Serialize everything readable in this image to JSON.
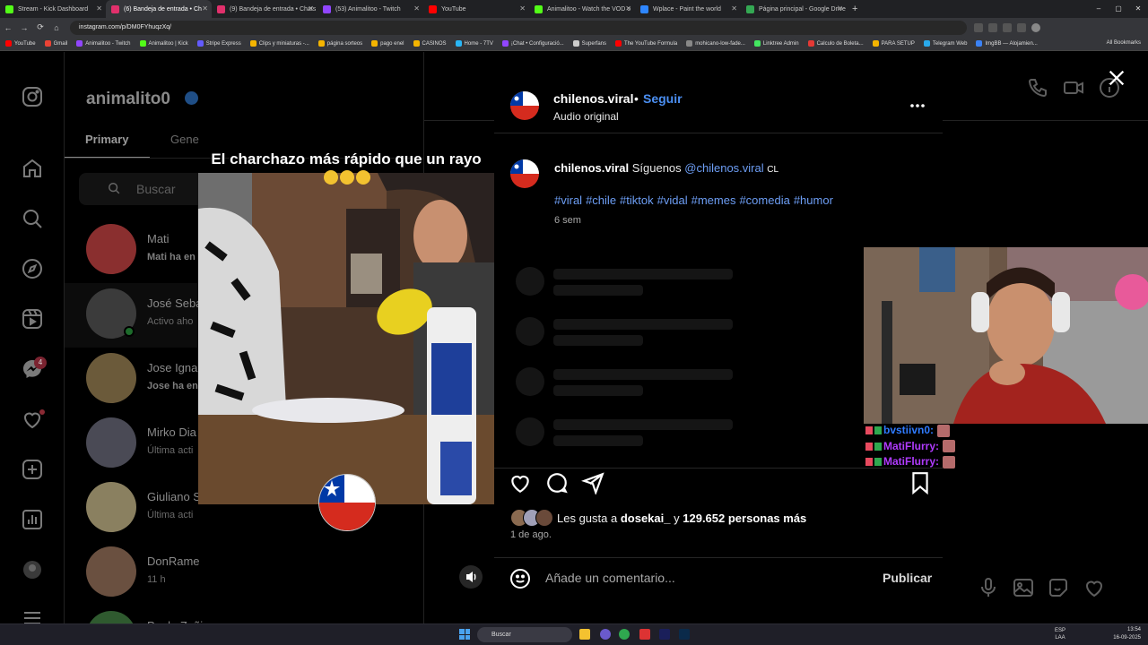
{
  "browser": {
    "tabs": [
      {
        "label": "Stream - Kick Dashboard",
        "color": "#53fc18",
        "active": false
      },
      {
        "label": "(6) Bandeja de entrada • Ch",
        "color": "#e1306c",
        "active": true
      },
      {
        "label": "(9) Bandeja de entrada • Chats",
        "color": "#e1306c",
        "active": false
      },
      {
        "label": "(53) Animalitoo - Twitch",
        "color": "#9146ff",
        "active": false
      },
      {
        "label": "YouTube",
        "color": "#ff0000",
        "active": false
      },
      {
        "label": "Animalitoo - Watch the VOD o",
        "color": "#53fc18",
        "active": false
      },
      {
        "label": "Wplace - Paint the world",
        "color": "#2e86ff",
        "active": false
      },
      {
        "label": "Página principal - Google Drive",
        "color": "#34a853",
        "active": false
      }
    ],
    "new_tab": "+",
    "url": "instagram.com/p/DM0FYhuqzXq/",
    "bookmarks": [
      {
        "label": "YouTube",
        "color": "#ff0000"
      },
      {
        "label": "Gmail",
        "color": "#ea4335"
      },
      {
        "label": "Animalitoo - Twitch",
        "color": "#9146ff"
      },
      {
        "label": "Animalitoo | Kick",
        "color": "#53fc18"
      },
      {
        "label": "Stripe Express",
        "color": "#635bff"
      },
      {
        "label": "Clips y miniaturas -...",
        "color": "#f4b400"
      },
      {
        "label": "página sorteos",
        "color": "#f4b400"
      },
      {
        "label": "pago enel",
        "color": "#f4b400"
      },
      {
        "label": "CASINOS",
        "color": "#f4b400"
      },
      {
        "label": "Home - 7TV",
        "color": "#29b6f6"
      },
      {
        "label": "¡Chat • Configuració...",
        "color": "#9146ff"
      },
      {
        "label": "Superfans",
        "color": "#cccccc"
      },
      {
        "label": "The YouTube Formula",
        "color": "#ff0000"
      },
      {
        "label": "mohicano-low-fade...",
        "color": "#888888"
      },
      {
        "label": "Linktree Admin",
        "color": "#43e660"
      },
      {
        "label": "Calculo de Boleta...",
        "color": "#e53935"
      },
      {
        "label": "PARA SETUP",
        "color": "#f4b400"
      },
      {
        "label": "Telegram Web",
        "color": "#29a9eb"
      },
      {
        "label": "ImgBB — Alojamien...",
        "color": "#3b82f6"
      }
    ],
    "all_bookmarks": "All Bookmarks"
  },
  "inbox": {
    "username": "animalito0",
    "tabs": {
      "primary": "Primary",
      "general": "Gene"
    },
    "search_placeholder": "Buscar",
    "chats": [
      {
        "name": "Mati",
        "preview": "Mati ha en",
        "bold": true,
        "avatar_color": "#8a2f2f"
      },
      {
        "name": "José Seba",
        "preview": "Activo aho",
        "bold": false,
        "avatar_color": "#3b3b3b",
        "online": true
      },
      {
        "name": "Jose Igna",
        "preview": "Jose ha en",
        "bold": true,
        "avatar_color": "#6b5a3a"
      },
      {
        "name": "Mirko Dia",
        "preview": "Última acti",
        "bold": false,
        "avatar_color": "#4a4a55"
      },
      {
        "name": "Giuliano S",
        "preview": "Última acti",
        "bold": false,
        "avatar_color": "#8a8060"
      },
      {
        "name": "DonRame",
        "preview": "11 h",
        "bold": false,
        "avatar_color": "#6a5040"
      },
      {
        "name": "Paulo Zuñiga",
        "preview": "",
        "bold": false,
        "avatar_color": "#2f5a2f"
      }
    ],
    "nav_badge": "4"
  },
  "media": {
    "caption": "El charchazo más rápido que un rayo"
  },
  "post": {
    "username": "chilenos.viral",
    "separator": "•",
    "follow": "Seguir",
    "audio": "Audio original",
    "comment_user": "chilenos.viral",
    "comment_text": "Síguenos",
    "comment_mention": "@chilenos.viral",
    "comment_suffix": "CL",
    "hashtags": [
      "#viral",
      "#chile",
      "#tiktok",
      "#vidal",
      "#memes",
      "#comedia",
      "#humor"
    ],
    "comment_age": "6 sem",
    "likes_prefix": "Les gusta a",
    "likes_user": "dosekai_",
    "likes_middle": "y",
    "likes_count": "129.652 personas más",
    "date": "1 de ago.",
    "comment_placeholder": "Añade un comentario...",
    "publish": "Publicar"
  },
  "stream_chat": [
    {
      "user": "bvstiivn0:",
      "color": "#2f7bff"
    },
    {
      "user": "MatiFlurry:",
      "color": "#b13bff"
    },
    {
      "user": "MatiFlurry:",
      "color": "#b13bff"
    }
  ],
  "taskbar": {
    "search": "Buscar",
    "lang_1": "ESP",
    "lang_2": "LAA",
    "time": "13:54",
    "date": "16-09-2025"
  }
}
